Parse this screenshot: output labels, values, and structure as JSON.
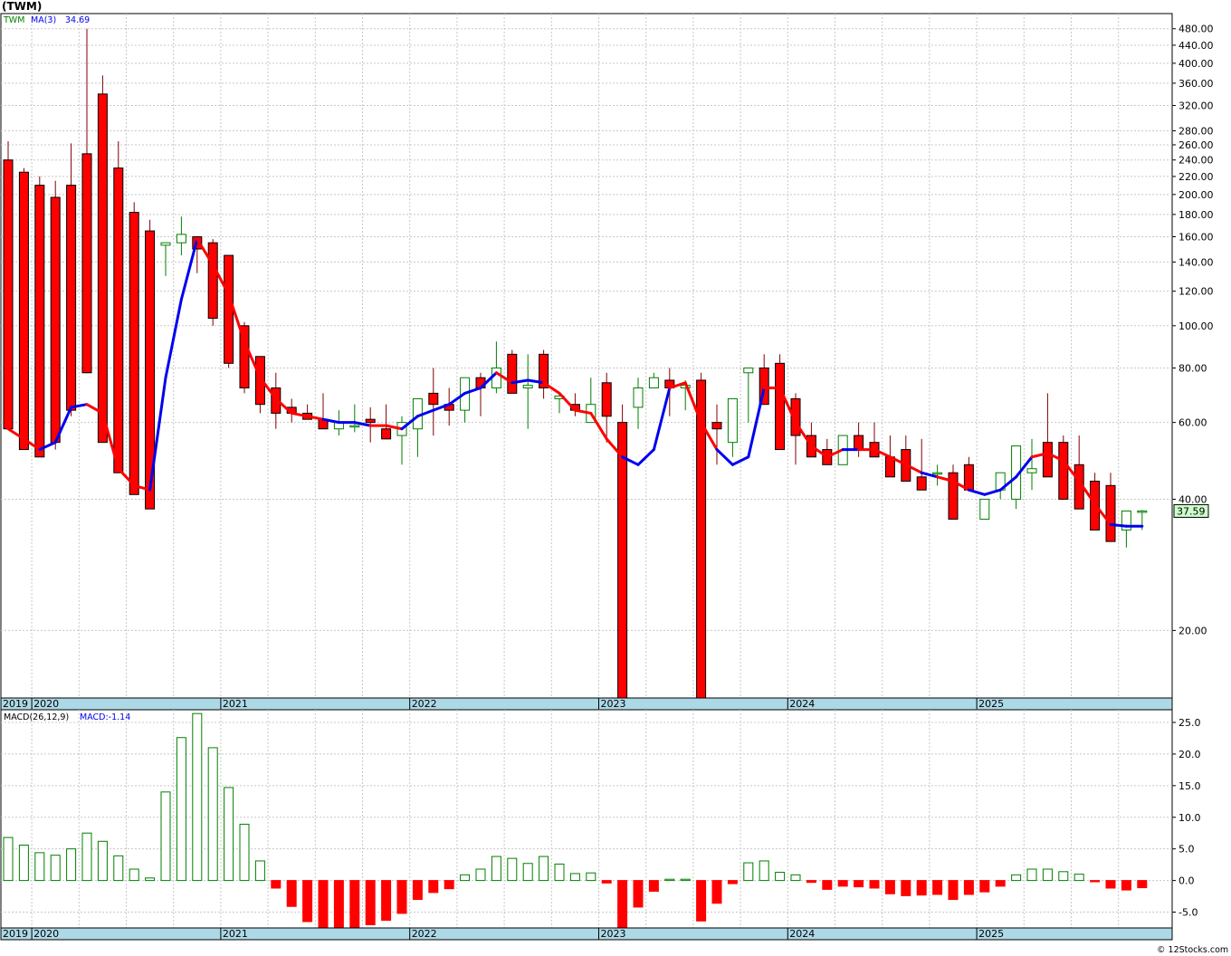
{
  "title": "(TWM)",
  "watermark": "© 12Stocks.com",
  "colors": {
    "up": "#008000",
    "down": "#ff0000",
    "ma_up": "#0000ee",
    "ma_down": "#ff0000",
    "axis_band": "#add8e6",
    "last_price_bg": "#ccffcc",
    "grid": "#c8c8c8"
  },
  "price_panel": {
    "symbol": "TWM",
    "ma_label": "MA(3)",
    "ma_value": "34.69",
    "last_price": "37.59",
    "y_ticks": [
      "480.00",
      "440.00",
      "400.00",
      "360.00",
      "320.00",
      "280.00",
      "260.00",
      "240.00",
      "220.00",
      "200.00",
      "180.00",
      "160.00",
      "140.00",
      "120.00",
      "100.00",
      "80.00",
      "60.00",
      "40.00",
      "20.00"
    ]
  },
  "macd_panel": {
    "label": "MACD(26,12,9)",
    "value_label": "MACD:-1.14",
    "y_ticks": [
      "25.0",
      "20.0",
      "15.0",
      "10.0",
      "5.0",
      "0.0",
      "-5.0"
    ]
  },
  "years": [
    "2019",
    "2020",
    "2021",
    "2022",
    "2023",
    "2024",
    "2025"
  ],
  "chart_data": [
    {
      "type": "candlestick",
      "title": "(TWM)",
      "scale": "log",
      "ylim": [
        14,
        520
      ],
      "interval": "monthly",
      "periods": [
        "2019-11",
        "2019-12",
        "2020-01",
        "2020-02",
        "2020-03",
        "2020-04",
        "2020-05",
        "2020-06",
        "2020-07",
        "2020-08",
        "2020-09",
        "2020-10",
        "2020-11",
        "2020-12",
        "2021-01",
        "2021-02",
        "2021-03",
        "2021-04",
        "2021-05",
        "2021-06",
        "2021-07",
        "2021-08",
        "2021-09",
        "2021-10",
        "2021-11",
        "2021-12",
        "2022-01",
        "2022-02",
        "2022-03",
        "2022-04",
        "2022-05",
        "2022-06",
        "2022-07",
        "2022-08",
        "2022-09",
        "2022-10",
        "2022-11",
        "2022-12",
        "2023-01",
        "2023-02",
        "2023-03",
        "2023-04",
        "2023-05",
        "2023-06",
        "2023-07",
        "2023-08",
        "2023-09",
        "2023-10",
        "2023-11",
        "2023-12",
        "2024-01",
        "2024-02",
        "2024-03",
        "2024-04",
        "2024-05",
        "2024-06",
        "2024-07",
        "2024-08",
        "2024-09",
        "2024-10",
        "2024-11",
        "2024-12",
        "2025-01",
        "2025-02",
        "2025-03",
        "2025-04",
        "2025-05",
        "2025-06",
        "2025-07",
        "2025-08",
        "2025-09",
        "2025-10",
        "2025-11"
      ],
      "open": [
        240,
        225,
        210,
        197,
        210,
        248,
        340,
        230,
        182,
        165,
        153,
        155,
        160,
        155,
        145,
        100,
        85,
        72,
        65,
        63,
        61,
        58,
        59,
        61,
        58,
        56,
        58,
        70,
        66,
        64,
        76,
        72,
        86,
        72,
        86,
        68,
        66,
        60,
        74,
        60,
        65,
        72,
        75,
        72,
        75,
        60,
        54,
        78,
        80,
        82,
        68,
        56,
        52,
        48,
        56,
        54,
        50,
        52,
        45,
        46,
        46,
        48,
        36,
        42,
        40,
        46,
        54,
        54,
        48,
        44,
        43,
        34,
        37.5
      ],
      "high": [
        265,
        230,
        220,
        215,
        262,
        480,
        375,
        265,
        192,
        175,
        155,
        178,
        160,
        158,
        145,
        102,
        85,
        78,
        68,
        66,
        70,
        64,
        66,
        65,
        66,
        62,
        60,
        80,
        72,
        68,
        78,
        92,
        88,
        86,
        88,
        70,
        70,
        76,
        78,
        66,
        76,
        78,
        80,
        75,
        78,
        66,
        58,
        80,
        86,
        86,
        70,
        60,
        55,
        52,
        60,
        60,
        56,
        56,
        55,
        48,
        48,
        50,
        40,
        46,
        46,
        55,
        70,
        56,
        56,
        46,
        46,
        34.5,
        37.8
      ],
      "low": [
        58,
        52,
        50,
        52,
        62,
        78,
        54,
        46,
        41,
        38,
        130,
        145,
        132,
        100,
        80,
        70,
        63,
        58,
        60,
        62,
        58,
        56,
        57,
        54,
        56,
        48,
        50,
        56,
        59,
        60,
        62,
        70,
        74,
        58,
        68,
        63,
        62,
        60,
        54,
        60,
        58,
        72,
        62,
        64,
        62,
        48,
        50,
        60,
        72,
        60,
        48,
        52,
        50,
        48,
        50,
        52,
        48,
        45,
        42,
        43,
        43,
        43,
        36,
        40,
        38,
        42,
        48,
        48,
        42,
        38,
        33,
        31,
        34
      ],
      "close": [
        58,
        52,
        50,
        54,
        64,
        78,
        54,
        46,
        41,
        38,
        155,
        162,
        150,
        104,
        82,
        72,
        66,
        63,
        63,
        61,
        58,
        60,
        59,
        60,
        55,
        60,
        68,
        66,
        64,
        76,
        72,
        80,
        70,
        73,
        72,
        69,
        64,
        66,
        62,
        13,
        72,
        76,
        72,
        73,
        10,
        58,
        68,
        80,
        66,
        52,
        56,
        50,
        48,
        56,
        52,
        50,
        45,
        44,
        42,
        46,
        36,
        42,
        40,
        46,
        53,
        47,
        45,
        40,
        38,
        34,
        32,
        37.59,
        37.59
      ],
      "ma3": [
        58,
        55,
        52,
        54,
        65,
        66,
        63,
        47,
        43,
        42,
        76,
        115,
        158,
        138,
        118,
        92,
        76,
        68,
        63,
        62,
        61,
        60,
        60,
        59,
        59,
        58,
        62,
        64,
        66,
        70,
        72,
        78,
        74,
        75,
        74,
        70,
        64,
        63,
        55,
        50,
        48,
        52,
        72,
        74,
        60,
        52,
        48,
        50,
        72,
        72,
        60,
        53,
        50,
        52,
        52,
        52,
        50,
        48,
        46,
        45,
        44,
        42,
        41,
        42,
        45,
        50,
        51,
        49,
        44,
        39,
        35,
        34.69,
        34.69
      ],
      "ma3_color": [
        "down",
        "down",
        "down",
        "up",
        "up",
        "up",
        "down",
        "down",
        "down",
        "down",
        "up",
        "up",
        "up",
        "down",
        "down",
        "down",
        "down",
        "down",
        "down",
        "down",
        "down",
        "up",
        "up",
        "up",
        "down",
        "down",
        "up",
        "up",
        "up",
        "up",
        "up",
        "up",
        "down",
        "up",
        "up",
        "down",
        "down",
        "down",
        "down",
        "down",
        "up",
        "up",
        "up",
        "down",
        "down",
        "down",
        "up",
        "up",
        "up",
        "down",
        "down",
        "down",
        "down",
        "down",
        "up",
        "down",
        "down",
        "down",
        "down",
        "up",
        "down",
        "down",
        "up",
        "up",
        "up",
        "up",
        "down",
        "down",
        "down",
        "down",
        "down",
        "up",
        "up"
      ]
    },
    {
      "type": "bar",
      "title": "MACD(26,12,9)",
      "ylim": [
        -7.5,
        27
      ],
      "periods": [
        "2019-11",
        "2019-12",
        "2020-01",
        "2020-02",
        "2020-03",
        "2020-04",
        "2020-05",
        "2020-06",
        "2020-07",
        "2020-08",
        "2020-09",
        "2020-10",
        "2020-11",
        "2020-12",
        "2021-01",
        "2021-02",
        "2021-03",
        "2021-04",
        "2021-05",
        "2021-06",
        "2021-07",
        "2021-08",
        "2021-09",
        "2021-10",
        "2021-11",
        "2021-12",
        "2022-01",
        "2022-02",
        "2022-03",
        "2022-04",
        "2022-05",
        "2022-06",
        "2022-07",
        "2022-08",
        "2022-09",
        "2022-10",
        "2022-11",
        "2022-12",
        "2023-01",
        "2023-02",
        "2023-03",
        "2023-04",
        "2023-05",
        "2023-06",
        "2023-07",
        "2023-08",
        "2023-09",
        "2023-10",
        "2023-11",
        "2023-12",
        "2024-01",
        "2024-02",
        "2024-03",
        "2024-04",
        "2024-05",
        "2024-06",
        "2024-07",
        "2024-08",
        "2024-09",
        "2024-10",
        "2024-11",
        "2024-12",
        "2025-01",
        "2025-02",
        "2025-03",
        "2025-04",
        "2025-05",
        "2025-06",
        "2025-07",
        "2025-08",
        "2025-09",
        "2025-10",
        "2025-11"
      ],
      "values": [
        6.8,
        5.6,
        4.4,
        4.0,
        5.0,
        7.5,
        6.2,
        3.9,
        1.8,
        0.4,
        14.0,
        22.6,
        26.4,
        21.0,
        14.7,
        8.9,
        3.1,
        -1.2,
        -4.1,
        -6.5,
        -7.5,
        -7.5,
        -7.5,
        -7.0,
        -6.3,
        -5.2,
        -3.0,
        -1.9,
        -1.3,
        0.9,
        1.8,
        3.8,
        3.5,
        2.7,
        3.8,
        2.6,
        1.1,
        1.2,
        -0.4,
        -7.5,
        -4.2,
        -1.7,
        0.2,
        0.2,
        -6.4,
        -3.6,
        -0.5,
        2.8,
        3.1,
        1.3,
        0.9,
        -0.3,
        -1.4,
        -0.9,
        -1.0,
        -1.2,
        -2.1,
        -2.4,
        -2.3,
        -2.2,
        -3.0,
        -2.2,
        -1.8,
        -0.9,
        0.9,
        1.8,
        1.8,
        1.4,
        1.0,
        -0.2,
        -1.2,
        -1.5,
        -1.14
      ]
    }
  ]
}
